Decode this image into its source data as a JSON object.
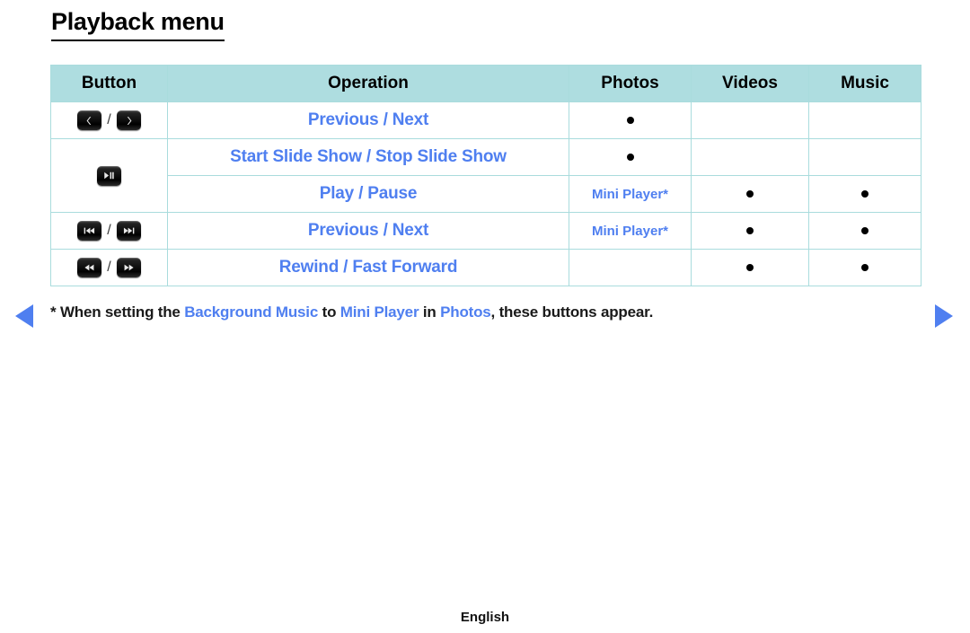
{
  "page": {
    "title": "Playback menu",
    "footer_language": "English"
  },
  "table": {
    "headers": [
      "Button",
      "Operation",
      "Photos",
      "Videos",
      "Music"
    ],
    "rows": [
      {
        "buttons": [
          "chevron-left",
          "chevron-right"
        ],
        "button_separator": "/",
        "operation": "Previous / Next",
        "photos": "●",
        "videos": "",
        "music": ""
      },
      {
        "buttons": [
          "play-pause"
        ],
        "button_separator": "",
        "operation": "Start Slide Show / Stop Slide Show",
        "photos": "●",
        "videos": "",
        "music": ""
      },
      {
        "buttons": [],
        "button_separator": "",
        "operation": "Play / Pause",
        "photos": "Mini Player*",
        "videos": "●",
        "music": "●"
      },
      {
        "buttons": [
          "skip-previous",
          "skip-next"
        ],
        "button_separator": "/",
        "operation": "Previous / Next",
        "photos": "Mini Player*",
        "videos": "●",
        "music": "●"
      },
      {
        "buttons": [
          "rewind",
          "fast-forward"
        ],
        "button_separator": "/",
        "operation": "Rewind / Fast Forward",
        "photos": "",
        "videos": "●",
        "music": "●"
      }
    ]
  },
  "footnote": {
    "prefix": "* When setting the ",
    "term1": "Background Music",
    "mid1": " to ",
    "term2": "Mini Player",
    "mid2": " in ",
    "term3": "Photos",
    "suffix": ", these buttons appear."
  },
  "nav": {
    "prev_label": "prev-page-arrow",
    "next_label": "next-page-arrow"
  },
  "colors": {
    "header_bg": "#aedde0",
    "border": "#a9dcdd",
    "accent_blue": "#4f7ff0",
    "text": "#000000"
  }
}
